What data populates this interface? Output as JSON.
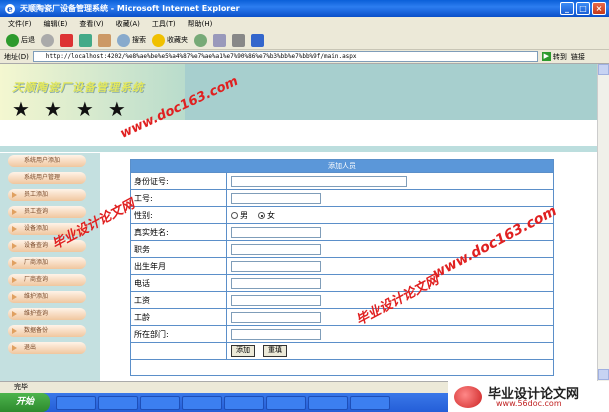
{
  "window": {
    "title": "天顺陶瓷厂设备管理系统 - Microsoft Internet Explorer",
    "buttons": [
      "_",
      "□",
      "×"
    ]
  },
  "menu": [
    "文件(F)",
    "编辑(E)",
    "查看(V)",
    "收藏(A)",
    "工具(T)",
    "帮助(H)"
  ],
  "toolbar": {
    "back": "后退",
    "search": "搜索",
    "favorites": "收藏夹"
  },
  "address": {
    "label": "地址(D)",
    "url": "http://localhost:4202/%e8%ae%be%e5%a4%87%e7%ae%a1%e7%90%86%e7%b3%bb%e7%bb%9f/main.aspx",
    "go": "转到",
    "links": "链接"
  },
  "banner": {
    "site_name": "天顺陶瓷厂设备管理系统"
  },
  "sidebar": {
    "items": [
      "系统用户添加",
      "系统用户管理",
      "员工添加",
      "员工查询",
      "设备添加",
      "设备查询",
      "厂商添加",
      "厂商查询",
      "维护添加",
      "维护查询",
      "数据备份",
      "退出"
    ]
  },
  "form": {
    "title": "添加人员",
    "fields": [
      {
        "label": "身份证号:"
      },
      {
        "label": "工号:"
      },
      {
        "label": "性别:",
        "options": [
          "男",
          "女"
        ],
        "selected": "女"
      },
      {
        "label": "真实姓名:"
      },
      {
        "label": "职务"
      },
      {
        "label": "出生年月"
      },
      {
        "label": "电话"
      },
      {
        "label": "工资"
      },
      {
        "label": "工龄"
      },
      {
        "label": "所在部门:"
      }
    ],
    "add_button": "添加",
    "reset_button": "重填"
  },
  "watermarks": [
    "www.doc163.com",
    "毕业设计论文网",
    "毕业设计论文网",
    "www.doc163.com"
  ],
  "status": {
    "text": "完毕"
  },
  "taskbar": {
    "start": "开始",
    "tasks": [
      "",
      "",
      "",
      "",
      "",
      "",
      "",
      "",
      "",
      ""
    ]
  },
  "logo": {
    "big": "毕业设计论文网",
    "small": "www.56doc.com"
  }
}
